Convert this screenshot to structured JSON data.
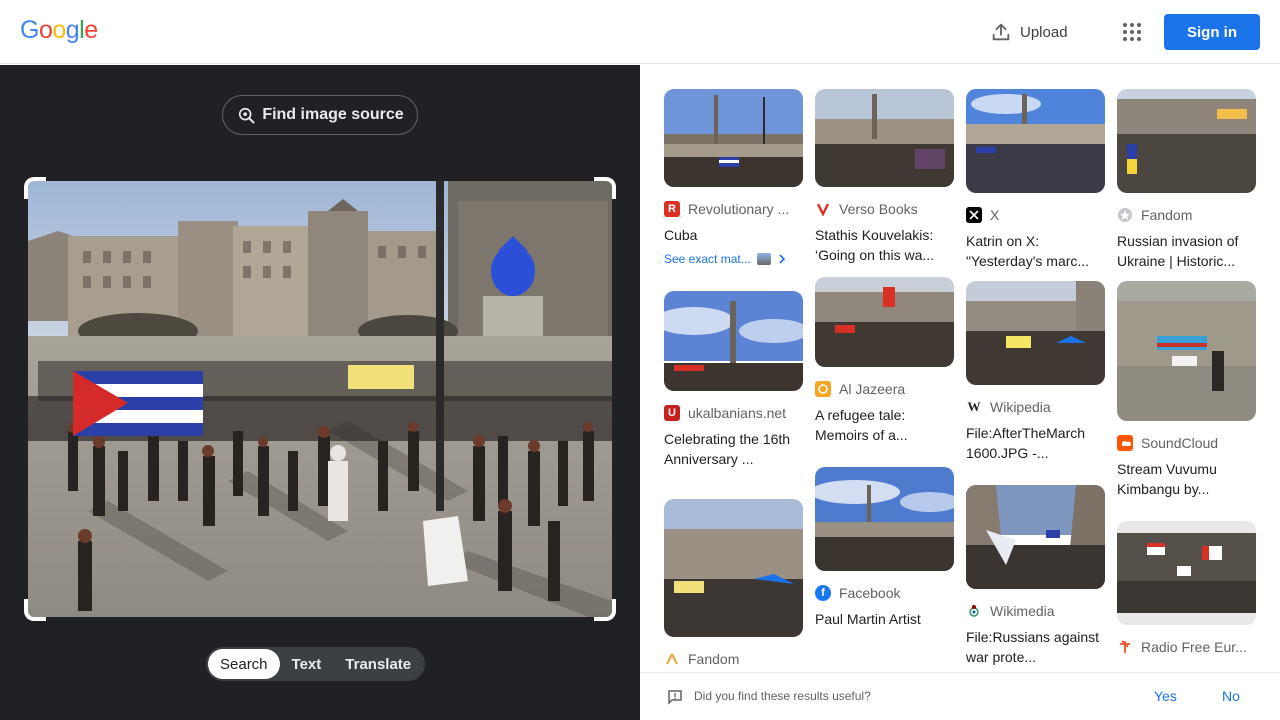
{
  "header": {
    "logo_letters": [
      "G",
      "o",
      "o",
      "g",
      "l",
      "e"
    ],
    "logo_colors": [
      "#4285F4",
      "#EA4335",
      "#FBBC05",
      "#4285F4",
      "#34A853",
      "#EA4335"
    ],
    "upload_label": "Upload",
    "signin_label": "Sign in"
  },
  "left": {
    "find_source_label": "Find image source",
    "modes": [
      "Search",
      "Text",
      "Translate"
    ],
    "active_mode": "Search"
  },
  "results": [
    {
      "source": "Revolutionary ...",
      "title": "Cuba",
      "icon": "rcg",
      "icon_color": "#d93025",
      "exact": "See exact mat..."
    },
    {
      "source": "Verso Books",
      "title": "Stathis Kouvelakis: ‘Going on this wa...",
      "icon": "verso-v",
      "icon_color": "#d93025"
    },
    {
      "source": "X",
      "title": "Katrin on X: \"Yesterday's marc...",
      "icon": "x",
      "icon_color": "#000000"
    },
    {
      "source": "Fandom",
      "title": "Russian invasion of Ukraine | Historic...",
      "icon": "fandom",
      "icon_color": "#9aa0a6"
    },
    {
      "source": "ukalbanians.net",
      "title": "Celebrating the 16th Anniversary ...",
      "icon": "uk",
      "icon_color": "#c5221f"
    },
    {
      "source": "Al Jazeera",
      "title": "A refugee tale: Memoirs of a...",
      "icon": "aljazeera",
      "icon_color": "#f5a623"
    },
    {
      "source": "Wikipedia",
      "title": "File:AfterTheMarch 1600.JPG -...",
      "icon": "w",
      "icon_color": "#ffffff"
    },
    {
      "source": "SoundCloud",
      "title": "Stream Vuvumu Kimbangu by...",
      "icon": "soundcloud",
      "icon_color": "#ff5500"
    },
    {
      "source": "Fandom",
      "title": "",
      "icon": "fandom-a",
      "icon_color": "#ffffff"
    },
    {
      "source": "Facebook",
      "title": "Paul Martin Artist",
      "icon": "facebook",
      "icon_color": "#1877f2"
    },
    {
      "source": "Wikimedia",
      "title": "File:Russians against war prote...",
      "icon": "wikimedia",
      "icon_color": "#ffffff"
    },
    {
      "source": "Radio Free Eur...",
      "title": "",
      "icon": "rfe",
      "icon_color": "#ffffff"
    }
  ],
  "footer": {
    "question": "Did you find these results useful?",
    "yes": "Yes",
    "no": "No"
  }
}
